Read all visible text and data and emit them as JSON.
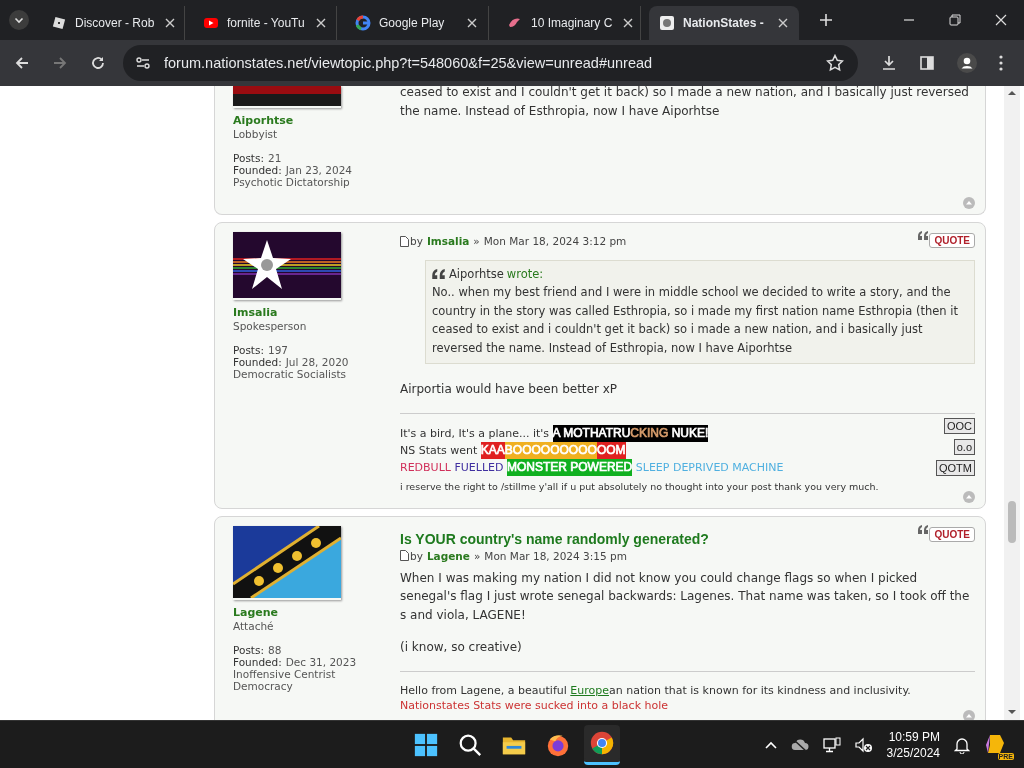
{
  "browser": {
    "tabs": [
      {
        "title": "Discover - Rob",
        "selected": false
      },
      {
        "title": "fornite - YouTu",
        "selected": false
      },
      {
        "title": "Google Play",
        "selected": false
      },
      {
        "title": "10 Imaginary C",
        "selected": false
      },
      {
        "title": "NationStates -",
        "selected": true
      }
    ],
    "address": "forum.nationstates.net/viewtopic.php?t=548060&f=25&view=unread#unread"
  },
  "posts": [
    {
      "author": "Aiporhtse",
      "rank": "Lobbyist",
      "stats": [
        {
          "label": "Posts:",
          "value": "21"
        },
        {
          "label": "Founded:",
          "value": "Jan 23, 2024"
        }
      ],
      "category": "Psychotic Dictatorship",
      "body": [
        "ceased to exist and I couldn't get it back) so I made a new nation, and I basically just reversed the name. Instead of Esthropia, now I have Aiporhtse"
      ]
    },
    {
      "author": "Imsalia",
      "rank": "Spokesperson",
      "stats": [
        {
          "label": "Posts:",
          "value": "197"
        },
        {
          "label": "Founded:",
          "value": "Jul 28, 2020"
        }
      ],
      "category": "Democratic Socialists",
      "byline": {
        "by": "by",
        "author": "Imsalia",
        "sep": "»",
        "date": "Mon Mar 18, 2024 3:12 pm"
      },
      "quote_button": "QUOTE",
      "quote": {
        "author": "Aiporhtse",
        "wrote": "wrote:",
        "text": "No.. when my best friend and I were in middle school we decided to write a story, and the country in the story was called Esthropia, so i made my first nation name Esthropia (then it ceased to exist and i couldn't get it back) so i made a new nation, and i basically just reversed the name. Instead of Esthropia, now I have Aiporhtse"
      },
      "body": [
        "Airportia would have been better xP"
      ],
      "signature": {
        "lines": [
          {
            "kind": "segments",
            "segments": [
              {
                "text": "It's a bird, It's a plane... it's "
              },
              {
                "kind": "highlight",
                "color": "#000000",
                "segments": [
                  {
                    "text": "A MOTHATRU"
                  },
                  {
                    "text": "CKING",
                    "color": "#d49a6a"
                  },
                  {
                    "text": " NUKE!"
                  }
                ]
              }
            ]
          },
          {
            "kind": "segments",
            "segments": [
              {
                "text": "NS Stats went "
              },
              {
                "kind": "highlight",
                "color": "#e02020",
                "segments": [
                  {
                    "text": "KAA"
                  }
                ]
              },
              {
                "kind": "highlight",
                "color": "#f0b020",
                "segments": [
                  {
                    "text": "BOOOOOOOOO",
                    "color": "#ffffff"
                  }
                ]
              },
              {
                "kind": "highlight",
                "color": "#e02020",
                "segments": [
                  {
                    "text": "OOM",
                    "color": "#ffffff"
                  }
                ]
              }
            ]
          },
          {
            "kind": "segments",
            "segments": [
              {
                "text": "REDBULL ",
                "color": "#d0305a"
              },
              {
                "text": "FUELLED ",
                "color": "#4030a0"
              },
              {
                "kind": "highlight",
                "color": "#10b020",
                "segments": [
                  {
                    "text": "MONSTER POWERED"
                  }
                ]
              },
              {
                "text": " SLEEP DEPRIVED MACHINE",
                "color": "#50b0e0"
              }
            ]
          },
          {
            "kind": "small",
            "text": "i reserve the right to /stillme y'all if u put absolutely no thought into your post thank you very much."
          }
        ],
        "badges": [
          "OOC",
          "o.o",
          "QOTM"
        ]
      }
    },
    {
      "author": "Lagene",
      "rank": "Attaché",
      "stats": [
        {
          "label": "Posts:",
          "value": "88"
        },
        {
          "label": "Founded:",
          "value": "Dec 31, 2023"
        }
      ],
      "category": "Inoffensive Centrist Democracy",
      "title": "Is YOUR country's name randomly generated?",
      "byline": {
        "by": "by",
        "author": "Lagene",
        "sep": "»",
        "date": "Mon Mar 18, 2024 3:15 pm"
      },
      "quote_button": "QUOTE",
      "body": [
        "When I was making my nation I did not know you could change flags so when I picked senegal's flag I just wrote senegal backwards: Lagenes. That name was taken, so I took off the s and viola, LAGENE!",
        "(i know, so creative)"
      ],
      "signature": {
        "lines": [
          {
            "kind": "segments",
            "segments": [
              {
                "text": "Hello from Lagene, a beautiful "
              },
              {
                "kind": "link",
                "text": "Europe"
              },
              {
                "text": "an nation that is known for its kindness and inclusivity."
              }
            ]
          },
          {
            "kind": "segments",
            "segments": [
              {
                "text": "Nationstates Stats were sucked into a black hole",
                "color": "#cc3333"
              }
            ]
          }
        ]
      }
    }
  ],
  "taskbar": {
    "apps": [
      {
        "selected": false
      },
      {
        "selected": false
      },
      {
        "selected": false
      },
      {
        "selected": false
      },
      {
        "selected": true
      }
    ],
    "time": "10:59 PM",
    "date": "3/25/2024",
    "badge": "PRE"
  }
}
